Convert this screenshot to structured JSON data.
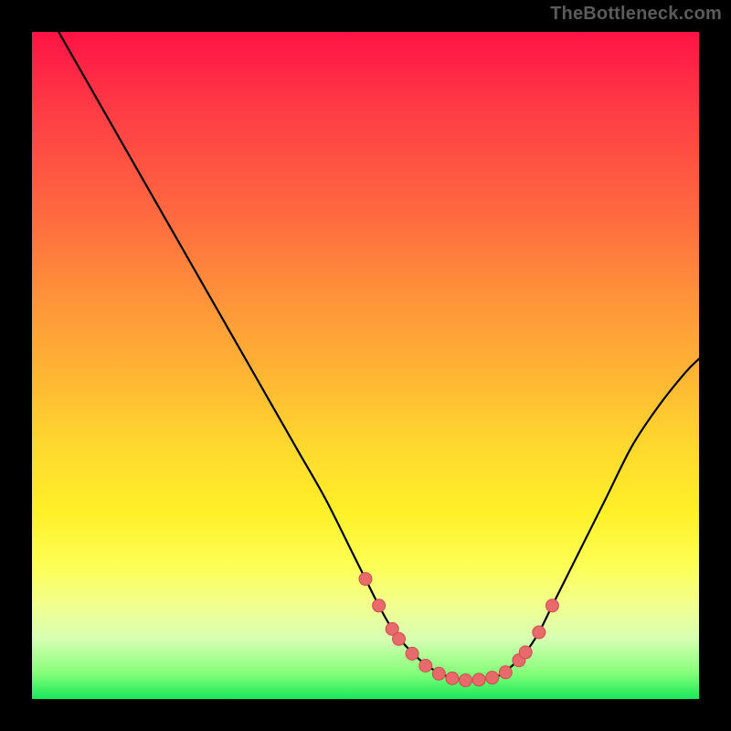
{
  "watermark": "TheBottleneck.com",
  "colors": {
    "background": "#000000",
    "curve_stroke": "#000000",
    "point_fill": "#e86a6a",
    "point_stroke": "#c94f4f"
  },
  "chart_data": {
    "type": "line",
    "title": "",
    "xlabel": "",
    "ylabel": "",
    "xlim": [
      0,
      100
    ],
    "ylim": [
      0,
      100
    ],
    "series": [
      {
        "name": "curve",
        "x": [
          4,
          8,
          12,
          16,
          20,
          24,
          28,
          32,
          36,
          40,
          44,
          48,
          50,
          52,
          54,
          56,
          58,
          60,
          62,
          64,
          66,
          68,
          70,
          72,
          74,
          76,
          78,
          82,
          86,
          90,
          94,
          98,
          100
        ],
        "y": [
          100,
          93,
          86,
          79,
          72,
          65,
          58,
          51,
          44,
          37,
          30,
          22,
          18,
          14,
          10.5,
          8,
          6,
          4.5,
          3.5,
          3,
          2.8,
          3,
          3.5,
          5,
          7,
          10,
          14,
          22,
          30,
          38,
          44,
          49,
          51
        ]
      }
    ],
    "points": {
      "name": "highlighted-points",
      "x": [
        50,
        52,
        54,
        55,
        57,
        59,
        61,
        63,
        65,
        67,
        69,
        71,
        73,
        74,
        76,
        78
      ],
      "y": [
        18,
        14,
        10.5,
        9,
        6.8,
        5,
        3.8,
        3.1,
        2.8,
        2.9,
        3.2,
        4,
        5.8,
        7,
        10,
        14
      ]
    }
  }
}
